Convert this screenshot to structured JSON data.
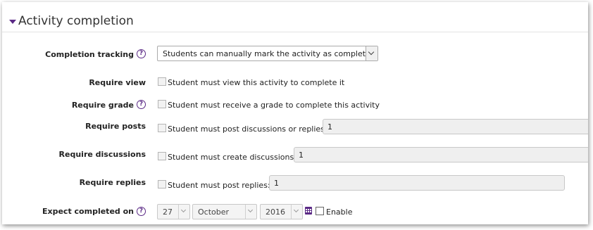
{
  "section": {
    "title": "Activity completion",
    "collapse_icon": "caret-down-icon"
  },
  "accent_color": "#5b2a86",
  "completion_tracking": {
    "label": "Completion tracking",
    "help_glyph": "?",
    "selected": "Students can manually mark the activity as completed"
  },
  "require_view": {
    "label": "Require view",
    "checkbox_text": "Student must view this activity to complete it",
    "checked": false
  },
  "require_grade": {
    "label": "Require grade",
    "help_glyph": "?",
    "checkbox_text": "Student must receive a grade to complete this activity",
    "checked": false
  },
  "require_posts": {
    "label": "Require posts",
    "checkbox_text": "Student must post discussions or replies:",
    "value": "1",
    "checked": false
  },
  "require_discussions": {
    "label": "Require discussions",
    "checkbox_text": "Student must create discussions:",
    "value": "1",
    "checked": false
  },
  "require_replies": {
    "label": "Require replies",
    "checkbox_text": "Student must post replies:",
    "value": "1",
    "checked": false
  },
  "expect_completed": {
    "label": "Expect completed on",
    "help_glyph": "?",
    "day": "27",
    "month": "October",
    "year": "2016",
    "calendar_icon": "calendar-icon",
    "enable_label": "Enable",
    "enabled": false
  }
}
